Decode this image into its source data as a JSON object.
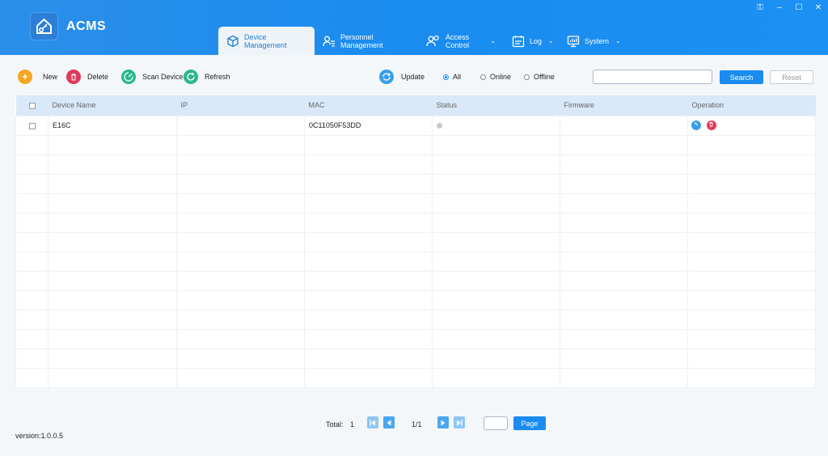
{
  "app": {
    "title": "ACMS"
  },
  "nav": {
    "tabs": [
      {
        "label": "Device Management",
        "icon": "cube-icon",
        "active": true
      },
      {
        "label": "Personnel Management",
        "icon": "person-list-icon",
        "active": false
      },
      {
        "label": "Access Control",
        "icon": "people-icon",
        "active": false,
        "dropdown": true
      },
      {
        "label": "Log",
        "icon": "calendar-icon",
        "active": false,
        "dropdown": true
      },
      {
        "label": "System",
        "icon": "monitor-icon",
        "active": false,
        "dropdown": true
      }
    ]
  },
  "toolbar": {
    "new_label": "New",
    "delete_label": "Delete",
    "scan_label": "Scan Device",
    "refresh_label": "Refresh",
    "update_label": "Update",
    "filter_all": "All",
    "filter_online": "Online",
    "filter_offline": "Offline",
    "selected_filter": "All",
    "search_value": "",
    "search_label": "Search",
    "reset_label": "Reset"
  },
  "table": {
    "headers": [
      "Device Name",
      "IP",
      "MAC",
      "Status",
      "Firmware",
      "Operation"
    ],
    "rows": [
      {
        "device_name": "E16C",
        "ip": "",
        "mac": "0C11050F53DD",
        "status": "offline",
        "firmware": ""
      }
    ]
  },
  "pager": {
    "total_label": "Total:",
    "total": "1",
    "page_info": "1/1",
    "page_input": "",
    "page_button": "Page"
  },
  "footer": {
    "version": "version:1.0.0.5"
  },
  "colors": {
    "accent": "#1a8cf0",
    "header_bg": "#2b8fe8",
    "table_header": "#d9e9f9",
    "new_icon": "#f5a623",
    "delete_icon": "#e03a5a",
    "scan_icon": "#2bb88a"
  }
}
